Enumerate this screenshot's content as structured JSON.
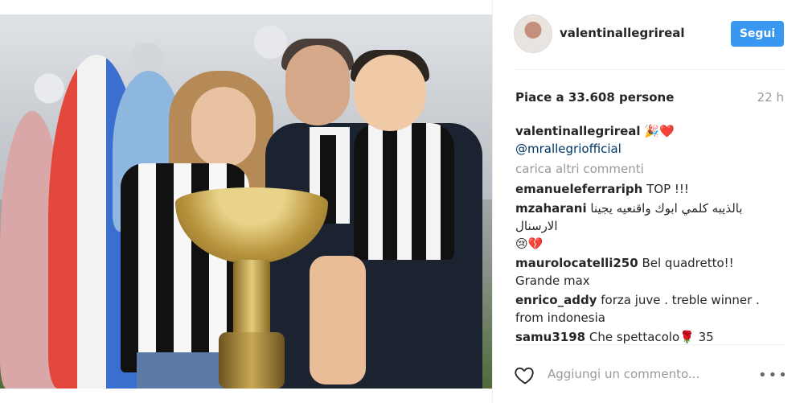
{
  "post": {
    "photo_alt": "",
    "username": "valentinallegrireal",
    "follow_label": "Segui",
    "likes_text": "Piace a 33.608 persone",
    "time": "22 h",
    "caption": {
      "user": "valentinallegrireal",
      "emoji": "🎉❤️",
      "mention": "@mrallegriofficial"
    },
    "load_more": "carica altri commenti",
    "comments": [
      {
        "user": "emanueleferrariph",
        "text": "TOP !!!"
      },
      {
        "user": "mzaharani",
        "text": "بالذيبه كلمي ابوك واقنعيه يجينا الارسنال",
        "text2": "😢💔"
      },
      {
        "user": "maurolocatelli250",
        "text": "Bel quadretto!!",
        "text2": "Grande max"
      },
      {
        "user": "enrico_addy",
        "text": "forza juve . treble winner .",
        "text2": "from indonesia"
      },
      {
        "user": "samu3198",
        "text": "Che spettacolo🌹 35"
      }
    ],
    "add_comment_placeholder": "Aggiungi un commento...",
    "more_icon": "•••"
  }
}
